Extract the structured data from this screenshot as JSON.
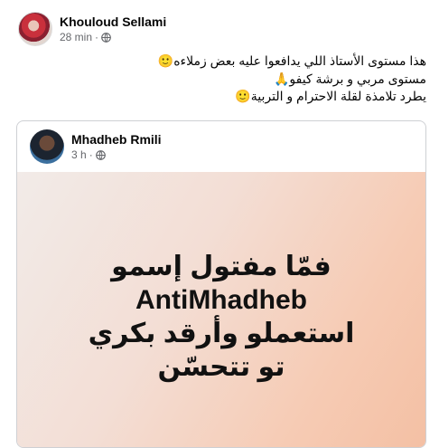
{
  "post": {
    "author": "Khouloud Sellami",
    "time": "28 min",
    "separator": "·",
    "privacy_icon": "globe-icon",
    "lines": [
      "هذا مستوى الأستاذ اللي يدافعوا عليه بعض زملاءه🙂",
      "مستوى مربي و برشة كيفو🙏",
      "يطرد تلامذة لقلة الاحترام و التربية🙂"
    ]
  },
  "shared": {
    "author": "Mhadheb Rmili",
    "time": "3 h",
    "separator": "·",
    "privacy_icon": "globe-icon",
    "card_lines": [
      "فمّا مفتول إسمو",
      "AntiMhadheb",
      "استعملو وأرقد بكري",
      "تو تتحسّن"
    ]
  },
  "colors": {
    "name_text": "#050505",
    "meta_text": "#65676b",
    "card_gradient_start": "#f2ebe8",
    "card_gradient_end": "#f4c0a4"
  }
}
